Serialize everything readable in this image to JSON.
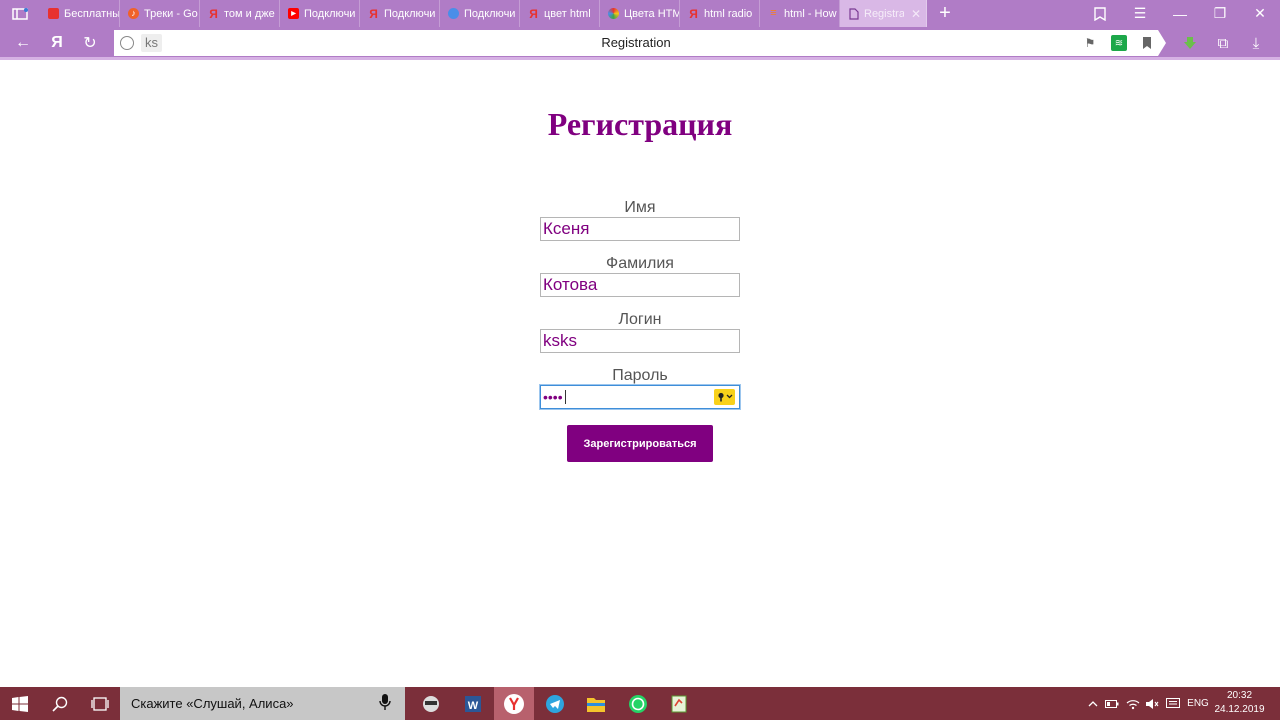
{
  "browser": {
    "tabs": [
      {
        "label": "Бесплатны",
        "favicon": "red-square-icon",
        "color": "#e8312f"
      },
      {
        "label": "Треки - Go",
        "favicon": "orange-music-icon",
        "color": "#f0622a"
      },
      {
        "label": "том и дже",
        "favicon": "yandex-y-icon",
        "color": "#e8312f"
      },
      {
        "label": "Подключи",
        "favicon": "youtube-icon",
        "color": "#ff0000"
      },
      {
        "label": "Подключи",
        "favicon": "yandex-y-icon",
        "color": "#e8312f"
      },
      {
        "label": "Подключи",
        "favicon": "chat-bubble-icon",
        "color": "#4a8ee8"
      },
      {
        "label": "цвет html",
        "favicon": "yandex-y-icon",
        "color": "#e8312f"
      },
      {
        "label": "Цвета HTM",
        "favicon": "color-wheel-icon",
        "color": "#3da34a"
      },
      {
        "label": "html radio",
        "favicon": "yandex-y-icon",
        "color": "#e8312f"
      },
      {
        "label": "html - How",
        "favicon": "stack-icon",
        "color": "#f48024"
      },
      {
        "label": "Registra",
        "favicon": "document-icon",
        "color": "#ffffff",
        "active": true
      }
    ],
    "address_bar": {
      "query_chip": "ks",
      "page_title": "Registration"
    }
  },
  "page": {
    "title": "Регистрация",
    "fields": {
      "first_name": {
        "label": "Имя",
        "value": "Ксеня"
      },
      "last_name": {
        "label": "Фамилия",
        "value": "Котова"
      },
      "login": {
        "label": "Логин",
        "value": "ksks"
      },
      "password": {
        "label": "Пароль",
        "masked_value": "••••"
      }
    },
    "submit_label": "Зарегистрироваться"
  },
  "taskbar": {
    "search_placeholder": "Скажите «Слушай, Алиса»",
    "language": "ENG",
    "time": "20:32",
    "date": "24.12.2019"
  },
  "colors": {
    "accent": "#800080",
    "browser_chrome": "#b07cc6",
    "taskbar": "#7b2f3a"
  }
}
